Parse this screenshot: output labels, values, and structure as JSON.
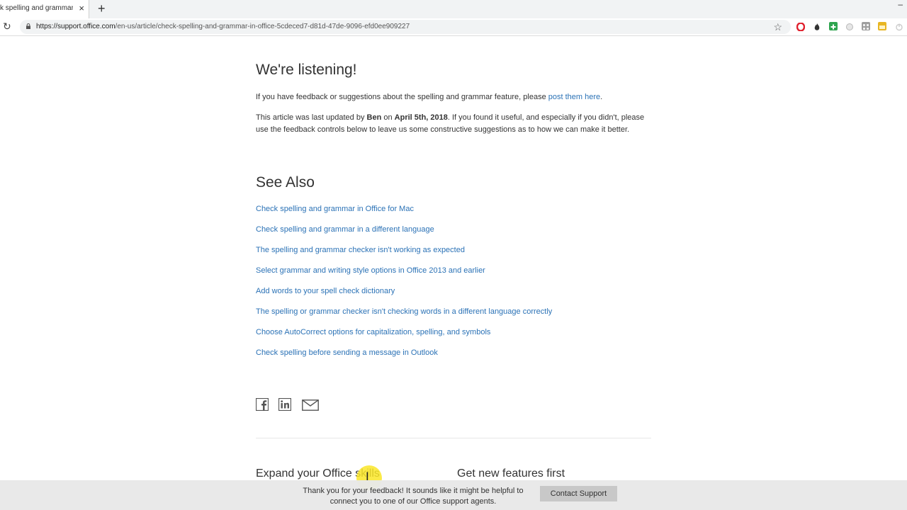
{
  "browser": {
    "tab_title": "k spelling and grammar in O",
    "tab_close": "×",
    "new_tab": "+",
    "minimize": "–",
    "url_host": "https://support.office.com",
    "url_path": "/en-us/article/check-spelling-and-grammar-in-office-5cdeced7-d81d-47de-9096-efd0ee909227",
    "reload_icon": "↻",
    "star_icon": "☆",
    "extensions": [
      {
        "name": "opera-extension-icon",
        "color": "#e0202d"
      },
      {
        "name": "flame-extension-icon",
        "color": "#333333"
      },
      {
        "name": "plus-extension-icon",
        "color": "#2ea44f"
      },
      {
        "name": "circle-extension-icon",
        "color": "#b8b8b8"
      },
      {
        "name": "grid-extension-icon",
        "color": "#9e9e9e"
      },
      {
        "name": "folder-extension-icon",
        "color": "#e8b623"
      },
      {
        "name": "power-extension-icon",
        "color": "#cccccc"
      }
    ]
  },
  "article": {
    "listening_heading": "We're listening!",
    "feedback_text": "If you have feedback or suggestions about the spelling and grammar feature, please ",
    "feedback_link": "post them here",
    "feedback_end": ".",
    "updated_prefix": "This article was last updated by ",
    "updated_author": "Ben",
    "updated_on": " on ",
    "updated_date": "April 5th, 2018",
    "updated_suffix": ". If you found it useful, and especially if you didn't, please use the feedback controls below to leave us some constructive suggestions as to how we can make it better.",
    "see_also_heading": "See Also",
    "see_also_links": [
      "Check spelling and grammar in Office for Mac",
      "Check spelling and grammar in a different language",
      "The spelling and grammar checker isn't working as expected",
      "Select grammar and writing style options in Office 2013 and earlier",
      "Add words to your spell check dictionary",
      "The spelling or grammar checker isn't checking words in a different language correctly",
      "Choose AutoCorrect options for capitalization, spelling, and symbols",
      "Check spelling before sending a message in Outlook"
    ],
    "expand_heading": "Expand your Office skills",
    "new_features_heading": "Get new features first"
  },
  "banner": {
    "text": "Thank you for your feedback! It sounds like it might be helpful to connect you to one of our Office support agents.",
    "button": "Contact Support"
  },
  "colors": {
    "link": "#2b72b6",
    "text": "#333333",
    "banner_bg": "#e8e8e8",
    "button_bg": "#c8c8c8",
    "cursor_highlight": "#fae628"
  }
}
